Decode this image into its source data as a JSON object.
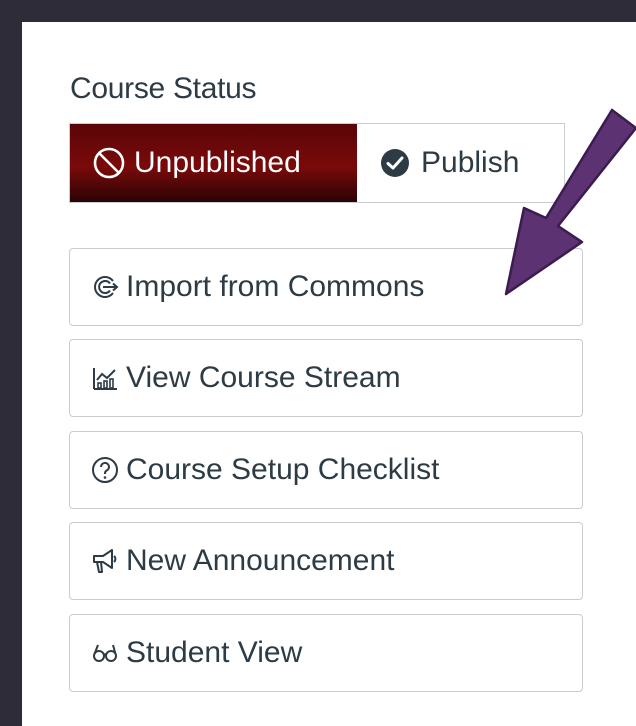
{
  "course_status": {
    "title": "Course Status",
    "unpublished_label": "Unpublished",
    "publish_label": "Publish"
  },
  "actions": [
    {
      "label": "Import from Commons",
      "icon": "commons-icon"
    },
    {
      "label": "View Course Stream",
      "icon": "stream-icon"
    },
    {
      "label": "Course Setup Checklist",
      "icon": "question-icon"
    },
    {
      "label": "New Announcement",
      "icon": "megaphone-icon"
    },
    {
      "label": "Student View",
      "icon": "glasses-icon"
    }
  ],
  "colors": {
    "frame": "#2f2c39",
    "unpublished_bg": "#6e0a0a",
    "text": "#2d3b45",
    "arrow": "#5c3272"
  }
}
